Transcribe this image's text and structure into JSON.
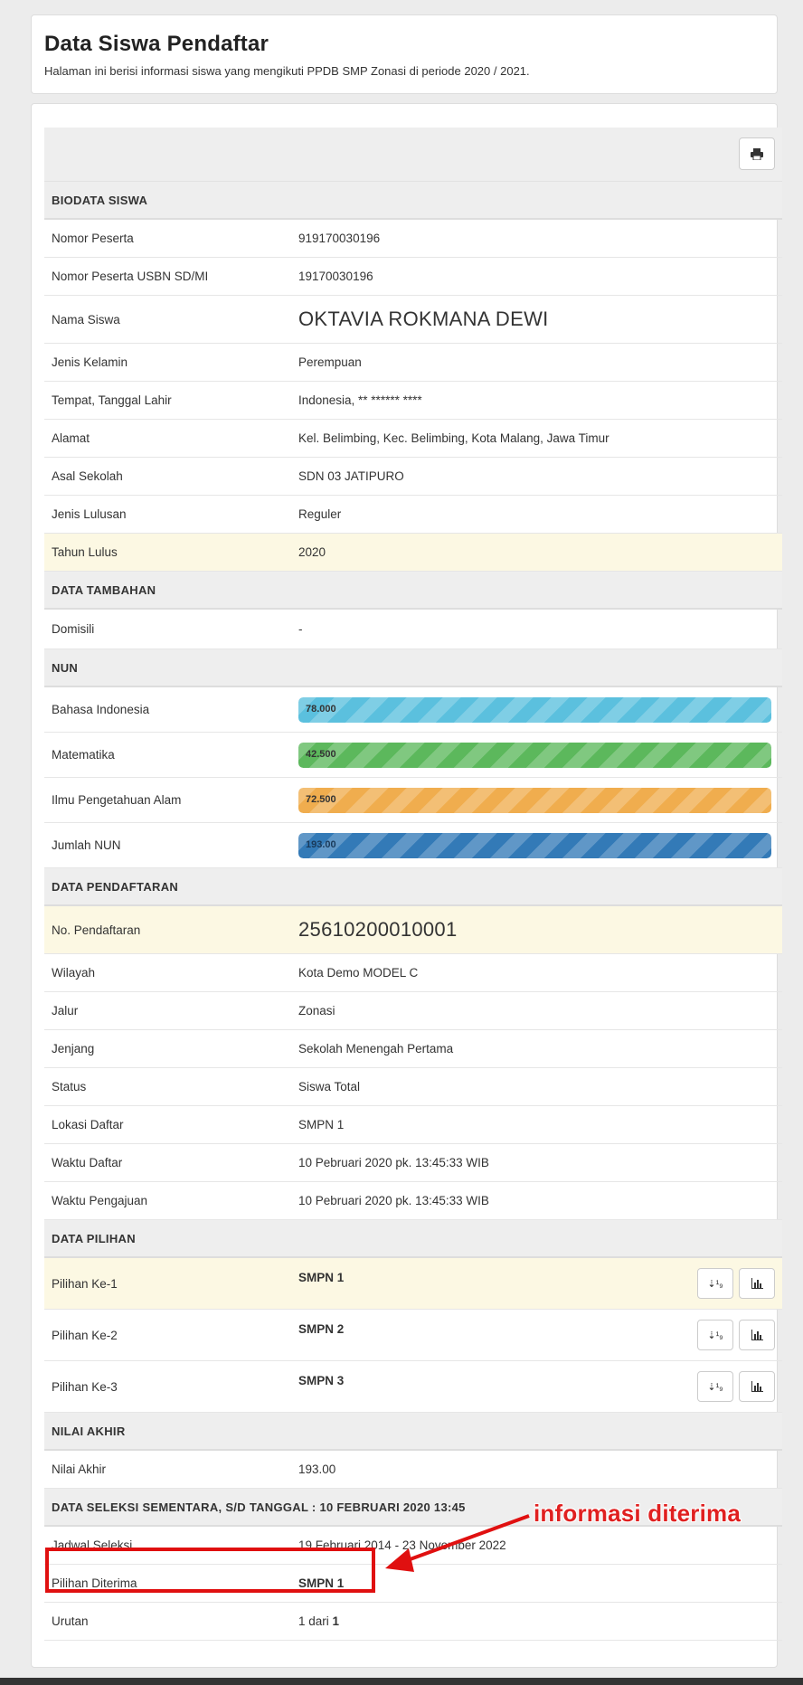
{
  "header": {
    "title": "Data Siswa Pendaftar",
    "subtitle": "Halaman ini berisi informasi siswa yang mengikuti PPDB SMP Zonasi di periode 2020 / 2021."
  },
  "sections": {
    "biodata": "BIODATA SISWA",
    "tambahan": "DATA TAMBAHAN",
    "nun": "NUN",
    "pendaftaran": "DATA PENDAFTARAN",
    "pilihan": "DATA PILIHAN",
    "nilai": "NILAI AKHIR",
    "seleksi": "DATA SELEKSI SEMENTARA, S/D TANGGAL : 10 FEBRUARI 2020 13:45"
  },
  "biodata": {
    "nomor_peserta": {
      "label": "Nomor Peserta",
      "value": "919170030196"
    },
    "nomor_usbn": {
      "label": "Nomor Peserta USBN SD/MI",
      "value": "19170030196"
    },
    "nama": {
      "label": "Nama Siswa",
      "value": "OKTAVIA ROKMANA DEWI"
    },
    "jenis_kelamin": {
      "label": "Jenis Kelamin",
      "value": "Perempuan"
    },
    "ttl": {
      "label": "Tempat, Tanggal Lahir",
      "value": "Indonesia, ** ****** ****"
    },
    "alamat": {
      "label": "Alamat",
      "value": "Kel. Belimbing, Kec. Belimbing, Kota Malang, Jawa Timur"
    },
    "asal_sekolah": {
      "label": "Asal Sekolah",
      "value": "SDN 03 JATIPURO"
    },
    "jenis_lulusan": {
      "label": "Jenis Lulusan",
      "value": "Reguler"
    },
    "tahun_lulus": {
      "label": "Tahun Lulus",
      "value": "2020"
    }
  },
  "tambahan": {
    "domisili": {
      "label": "Domisili",
      "value": "-"
    }
  },
  "nun": {
    "bindo": {
      "label": "Bahasa Indonesia",
      "value": "78.000",
      "color": "#5bc0de"
    },
    "mtk": {
      "label": "Matematika",
      "value": "42.500",
      "color": "#5cb85c"
    },
    "ipa": {
      "label": "Ilmu Pengetahuan Alam",
      "value": "72.500",
      "color": "#f0ad4e"
    },
    "jumlah": {
      "label": "Jumlah NUN",
      "value": "193.00",
      "color": "#337ab7"
    }
  },
  "pendaftaran": {
    "no": {
      "label": "No. Pendaftaran",
      "value": "25610200010001"
    },
    "wilayah": {
      "label": "Wilayah",
      "value": "Kota Demo MODEL C"
    },
    "jalur": {
      "label": "Jalur",
      "value": "Zonasi"
    },
    "jenjang": {
      "label": "Jenjang",
      "value": "Sekolah Menengah Pertama"
    },
    "status": {
      "label": "Status",
      "value": "Siswa Total"
    },
    "lokasi": {
      "label": "Lokasi Daftar",
      "value": "SMPN 1"
    },
    "waktu_daftar": {
      "label": "Waktu Daftar",
      "value": "10 Pebruari 2020 pk. 13:45:33 WIB"
    },
    "waktu_pengajuan": {
      "label": "Waktu Pengajuan",
      "value": "10 Pebruari 2020 pk. 13:45:33 WIB"
    }
  },
  "pilihan": [
    {
      "label": "Pilihan Ke-1",
      "value": "SMPN 1"
    },
    {
      "label": "Pilihan Ke-2",
      "value": "SMPN 2"
    },
    {
      "label": "Pilihan Ke-3",
      "value": "SMPN 3"
    }
  ],
  "nilai": {
    "akhir": {
      "label": "Nilai Akhir",
      "value": "193.00"
    }
  },
  "seleksi": {
    "jadwal": {
      "label": "Jadwal Seleksi",
      "value": "19 Februari 2014 - 23 November 2022"
    },
    "diterima": {
      "label": "Pilihan Diterima",
      "value": "SMPN 1"
    },
    "urutan": {
      "label": "Urutan",
      "value_pre": "1 dari ",
      "value_bold": "1"
    }
  },
  "annotation": {
    "text": "informasi diterima",
    "color": "#e02020"
  },
  "icons": {
    "print": "print-icon",
    "sort": "sort-numeric-icon",
    "chart": "bar-chart-icon"
  }
}
